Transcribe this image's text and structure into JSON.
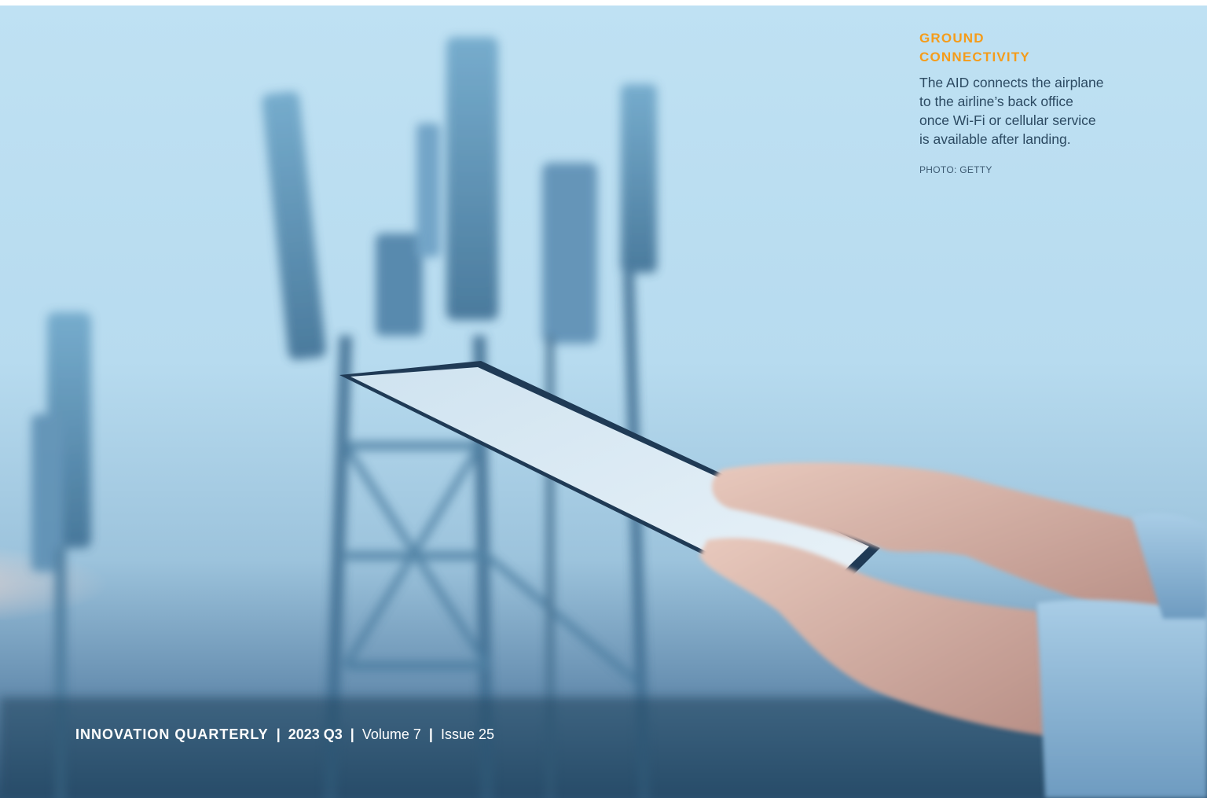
{
  "caption": {
    "title": "GROUND\nCONNECTIVITY",
    "body": "The AID connects the airplane\nto the airline’s back office\nonce Wi-Fi or cellular service\nis available after landing.",
    "credit": "PHOTO: GETTY"
  },
  "footer": {
    "publication": "INNOVATION QUARTERLY",
    "separator": "|",
    "period": "2023 Q3",
    "volume": "Volume 7",
    "issue": "Issue 25"
  },
  "colors": {
    "accent": "#f59c1a",
    "caption_text": "#2c4a62",
    "footer_text": "#ffffff"
  }
}
